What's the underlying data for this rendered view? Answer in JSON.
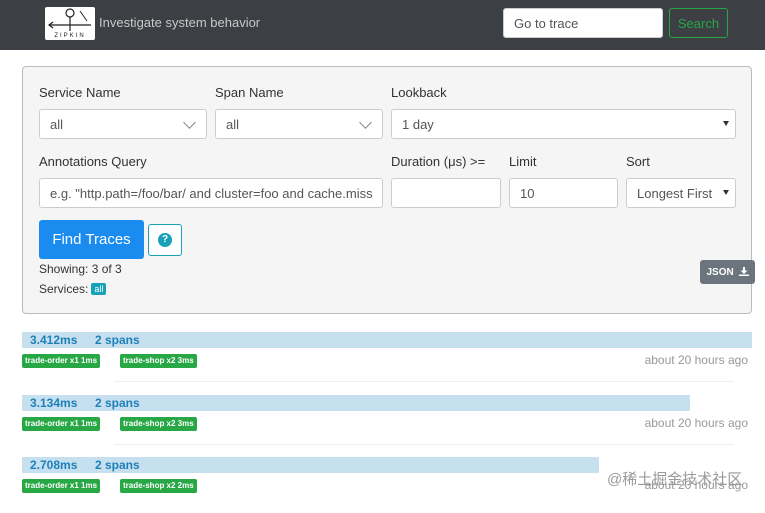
{
  "header": {
    "logo_text": "ZIPKIN",
    "tagline": "Investigate system behavior",
    "trace_input_placeholder": "Go to trace",
    "search_label": "Search"
  },
  "form": {
    "service_name_label": "Service Name",
    "service_name_value": "all",
    "span_name_label": "Span Name",
    "span_name_value": "all",
    "lookback_label": "Lookback",
    "lookback_value": "1 day",
    "annotations_label": "Annotations Query",
    "annotations_placeholder": "e.g. \"http.path=/foo/bar/ and cluster=foo and cache.miss",
    "duration_label": "Duration (μs) >=",
    "duration_value": "",
    "limit_label": "Limit",
    "limit_value": "10",
    "sort_label": "Sort",
    "sort_value": "Longest First",
    "find_label": "Find Traces",
    "help_icon": "?",
    "showing_text": "Showing: 3 of 3",
    "services_label": "Services:",
    "services_badge": "all",
    "json_label": "JSON"
  },
  "traces": [
    {
      "duration": "3.412ms",
      "spans": "2 spans",
      "tags": [
        "trade-order x1 1ms",
        "trade-shop x2 3ms"
      ],
      "ago": "about 20 hours ago",
      "bar_fraction": 1.0
    },
    {
      "duration": "3.134ms",
      "spans": "2 spans",
      "tags": [
        "trade-order x1 1ms",
        "trade-shop x2 3ms"
      ],
      "ago": "about 20 hours ago",
      "bar_fraction": 0.915
    },
    {
      "duration": "2.708ms",
      "spans": "2 spans",
      "tags": [
        "trade-order x1 1ms",
        "trade-shop x2 2ms"
      ],
      "ago": "about 20 hours ago",
      "bar_fraction": 0.791
    }
  ],
  "watermark": "@稀土掘金技术社区",
  "colors": {
    "header_bg": "#3c3f44",
    "primary": "#1a8cf0",
    "success": "#28a745",
    "info": "#17a2b8",
    "trace_bar": "#c7e0f0"
  }
}
